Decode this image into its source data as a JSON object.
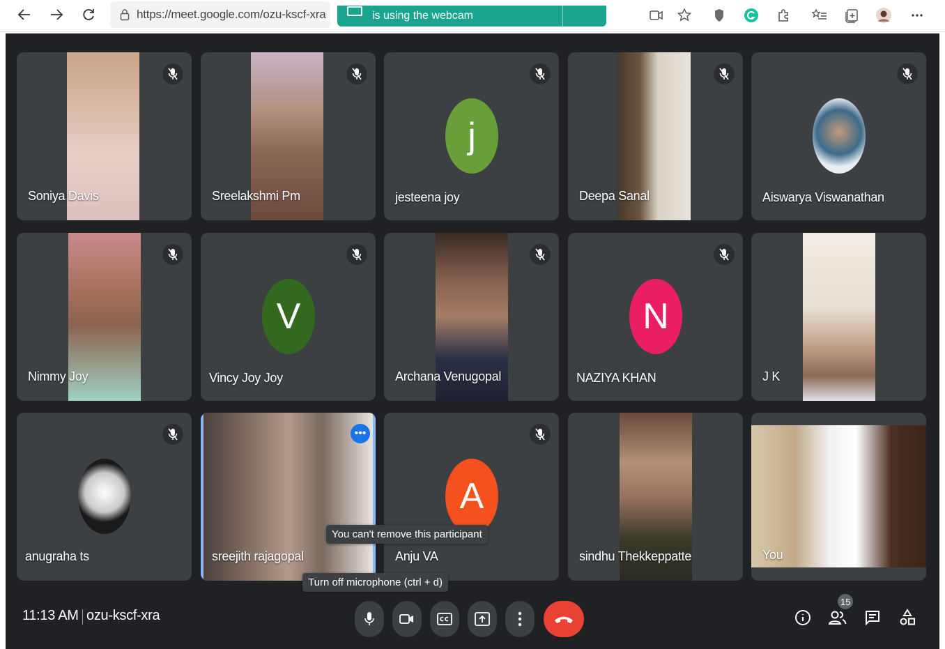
{
  "browser": {
    "url": "https://meet.google.com/ozu-kscf-xra",
    "banner_text": "is using the webcam"
  },
  "participants": [
    {
      "name": "Soniya Davis"
    },
    {
      "name": "Sreelakshmi Pm"
    },
    {
      "name": "jesteena joy",
      "initial": "j",
      "color": "#689f38"
    },
    {
      "name": "Deepa Sanal"
    },
    {
      "name": "Aiswarya Viswanathan"
    },
    {
      "name": "Nimmy Joy"
    },
    {
      "name": "Vincy Joy Joy",
      "initial": "V",
      "color": "#33691e"
    },
    {
      "name": "Archana Venugopal"
    },
    {
      "name": "NAZIYA KHAN",
      "initial": "N",
      "color": "#e91e63"
    },
    {
      "name": "J K"
    },
    {
      "name": "anugraha ts"
    },
    {
      "name": "sreejith rajagopal"
    },
    {
      "name": "Anju VA",
      "initial": "A",
      "color": "#f4511e"
    },
    {
      "name": "sindhu Thekkeppatte"
    },
    {
      "name": "You"
    }
  ],
  "tooltips": {
    "remove": "You can't remove this participant",
    "mic": "Turn off microphone (ctrl + d)"
  },
  "more_options_glyph": "•••",
  "meeting": {
    "time": "11:13 AM",
    "code": "ozu-kscf-xra"
  },
  "people_count": "15",
  "colors": {
    "stage": "#202124",
    "tile": "#3c4043",
    "end_call": "#ea4335",
    "active_border": "#8ab4f8",
    "banner": "#1aa38d"
  }
}
